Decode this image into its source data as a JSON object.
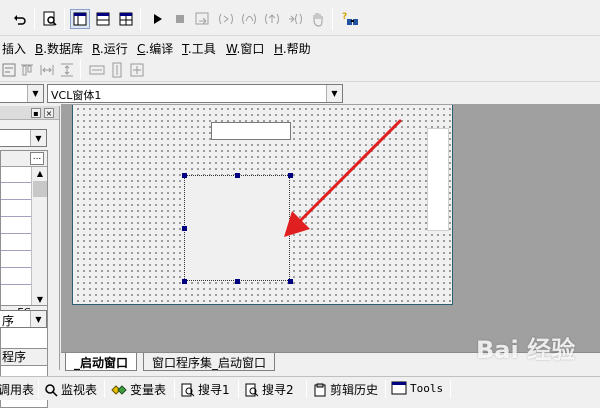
{
  "menubar": {
    "items": [
      {
        "key": "",
        "label": "插入"
      },
      {
        "key": "B",
        "label": ".数据库"
      },
      {
        "key": "R",
        "label": ".运行"
      },
      {
        "key": "C",
        "label": ".编译"
      },
      {
        "key": "T",
        "label": ".工具"
      },
      {
        "key": "W",
        "label": ".窗口"
      },
      {
        "key": "H",
        "label": ".帮助"
      }
    ]
  },
  "toolbar": {
    "icons": [
      "undo-icon",
      "find-icon",
      "layout-1-icon",
      "layout-2-icon",
      "layout-3-icon",
      "run-icon",
      "stop-icon",
      "step-icon",
      "step-into-icon",
      "step-over-icon",
      "step-out-icon",
      "breakpoint-icon",
      "hand-icon",
      "help-icon"
    ]
  },
  "left_panel": {
    "combo_value": "",
    "list_item_1": "EC",
    "combo2_value": "序",
    "tab_label": "程序",
    "dots_button": "..."
  },
  "combo": {
    "form_selector_value": "VCL窗体1"
  },
  "tabs": [
    {
      "label": "_启动窗口",
      "active": true
    },
    {
      "label": "窗口程序集_启动窗口",
      "active": false
    }
  ],
  "bottom_bar": {
    "items": [
      "调用表",
      "监视表",
      "变量表",
      "搜寻1",
      "搜寻2",
      "剪辑历史",
      "Tools"
    ]
  },
  "watermark": {
    "text": "Bai 经验"
  },
  "colors": {
    "annotation_arrow": "#e02020",
    "selection_handle": "#000080",
    "design_background": "#a0a0a0"
  }
}
